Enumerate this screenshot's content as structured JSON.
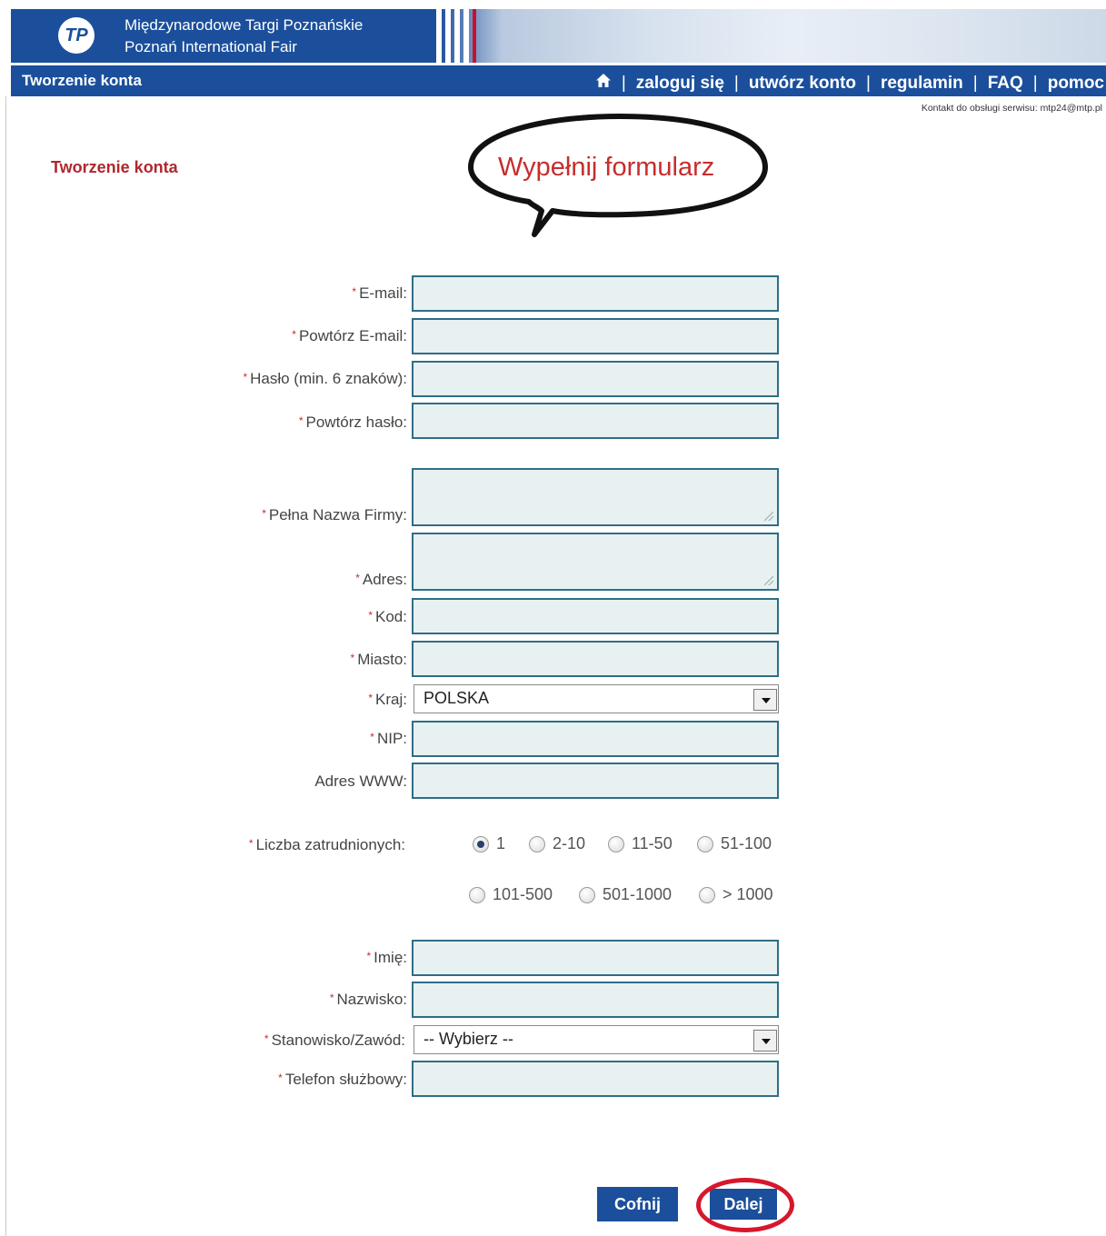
{
  "banner": {
    "org_name_pl": "Międzynarodowe Targi Poznańskie",
    "org_name_en": "Poznań International Fair",
    "logo_text": "TP"
  },
  "nav": {
    "title": "Tworzenie konta",
    "home_icon": "home-icon",
    "links": [
      "zaloguj się",
      "utwórz konto",
      "regulamin",
      "FAQ",
      "pomoc"
    ],
    "separator": "|"
  },
  "contact": "Kontakt do obsługi serwisu: mtp24@mtp.pl",
  "page_title": "Tworzenie konta",
  "annotation": "Wypełnij formularz",
  "required_mark": "*",
  "form": {
    "email": {
      "label": "E-mail:",
      "value": ""
    },
    "email_repeat": {
      "label": "Powtórz E-mail:",
      "value": ""
    },
    "password": {
      "label": "Hasło (min. 6 znaków):",
      "value": ""
    },
    "password_repeat": {
      "label": "Powtórz hasło:",
      "value": ""
    },
    "company": {
      "label": "Pełna Nazwa Firmy:",
      "value": ""
    },
    "address": {
      "label": "Adres:",
      "value": ""
    },
    "postal_code": {
      "label": "Kod:",
      "value": ""
    },
    "city": {
      "label": "Miasto:",
      "value": ""
    },
    "country": {
      "label": "Kraj:",
      "selected": "POLSKA"
    },
    "nip": {
      "label": "NIP:",
      "value": ""
    },
    "www": {
      "label": "Adres WWW:",
      "value": ""
    },
    "employees": {
      "label": "Liczba zatrudnionych:",
      "options": [
        "1",
        "2-10",
        "11-50",
        "51-100",
        "101-500",
        "501-1000",
        "> 1000"
      ],
      "selected": "1"
    },
    "first_name": {
      "label": "Imię:",
      "value": ""
    },
    "last_name": {
      "label": "Nazwisko:",
      "value": ""
    },
    "position": {
      "label": "Stanowisko/Zawód:",
      "selected": "-- Wybierz --"
    },
    "phone": {
      "label": "Telefon służbowy:",
      "value": ""
    }
  },
  "buttons": {
    "back": "Cofnij",
    "next": "Dalej"
  },
  "colors": {
    "brand_blue": "#1b4f9c",
    "accent_red": "#c62d2d",
    "field_bg": "#e8f1f1",
    "field_border": "#2f6d86"
  }
}
